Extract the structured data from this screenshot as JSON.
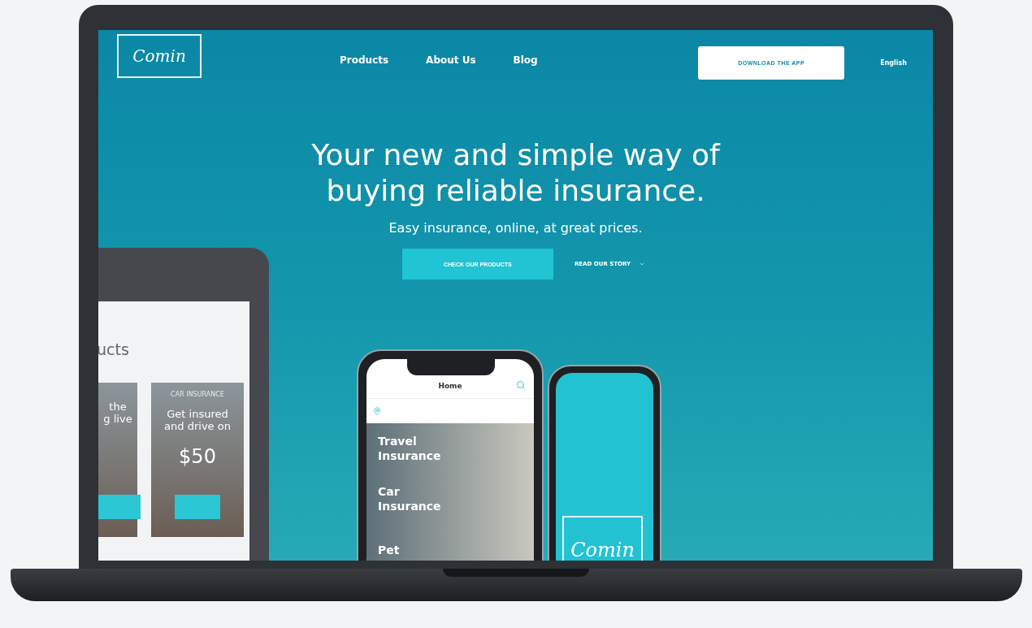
{
  "brand": {
    "logo": "Comin"
  },
  "nav": [
    {
      "label": "Products"
    },
    {
      "label": "About Us"
    },
    {
      "label": "Blog"
    }
  ],
  "download_button": "DOWNLOAD THE APP",
  "language": "English",
  "hero": {
    "title": "Your new and simple way of buying reliable insurance.",
    "subtitle": "Easy insurance, online, at great prices.",
    "primary_button": "CHECK OUR PRODUCTS",
    "secondary_link": "READ OUR STORY"
  },
  "tablet": {
    "heading": "ucts",
    "cards": [
      {
        "lines": [
          "the",
          "g live"
        ]
      },
      {
        "label": "CAR INSURANCE",
        "lines": [
          "Get insured",
          "and drive on"
        ],
        "price": "$50"
      }
    ]
  },
  "phone": {
    "title": "Home",
    "items": [
      "Travel Insurance",
      "Car Insurance",
      "Pet"
    ]
  },
  "phone2": {
    "logo": "Comin"
  }
}
